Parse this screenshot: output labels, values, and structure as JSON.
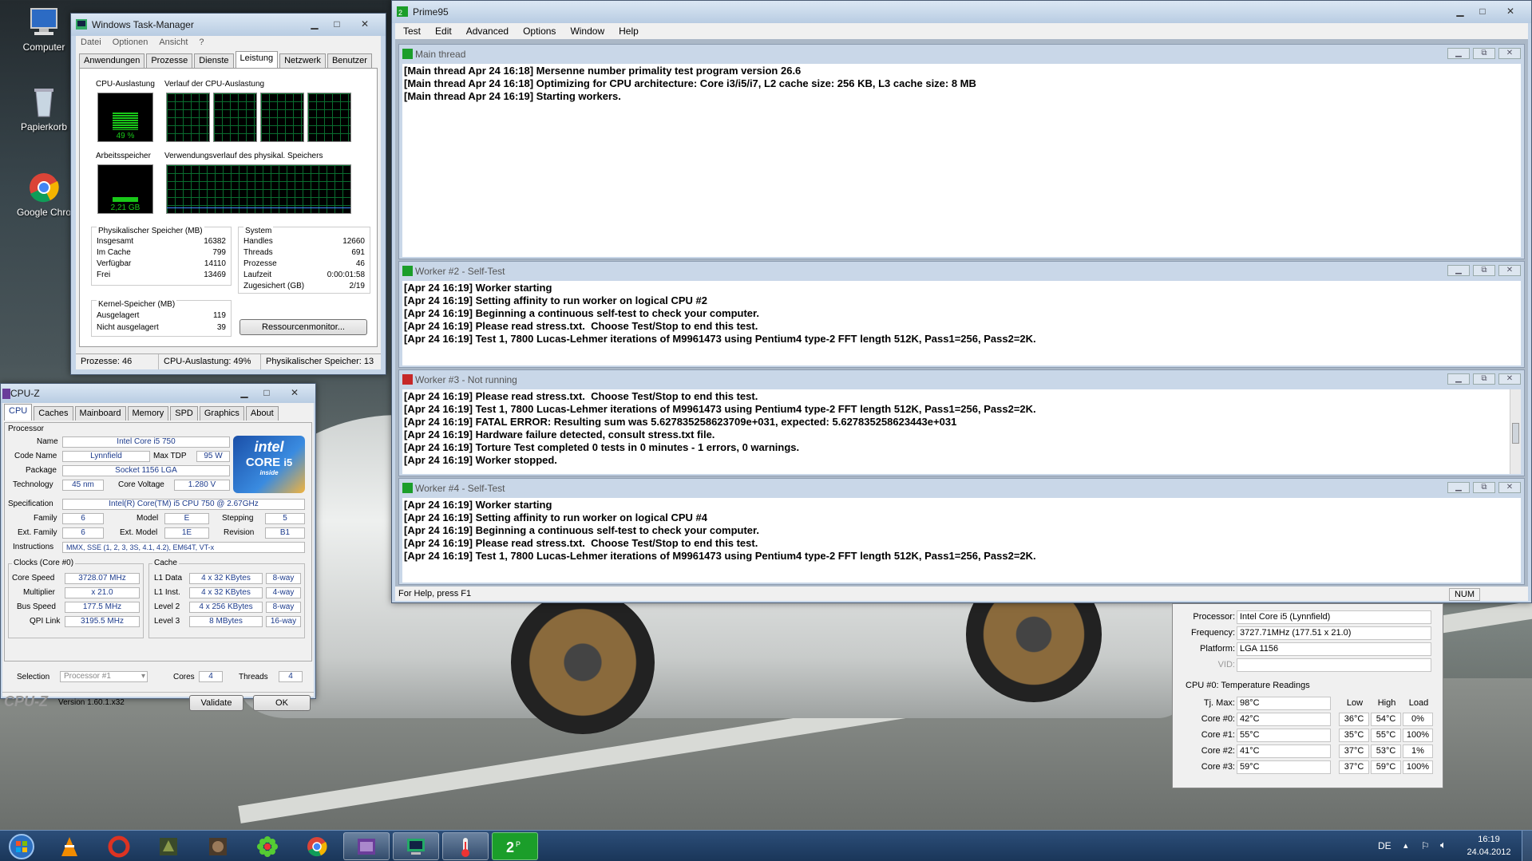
{
  "desktop": {
    "icons": [
      {
        "label": "Computer",
        "icon": "computer-icon"
      },
      {
        "label": "Papierkorb",
        "icon": "recycle-bin-icon"
      },
      {
        "label": "Google Chro",
        "icon": "chrome-icon"
      }
    ]
  },
  "taskmanager": {
    "title": "Windows Task-Manager",
    "menu": [
      "Datei",
      "Optionen",
      "Ansicht",
      "?"
    ],
    "tabs": [
      "Anwendungen",
      "Prozesse",
      "Dienste",
      "Leistung",
      "Netzwerk",
      "Benutzer"
    ],
    "active_tab": "Leistung",
    "cpu_label": "CPU-Auslastung",
    "cpu_history_label": "Verlauf der CPU-Auslastung",
    "cpu_value": "49 %",
    "cpu_percent": 49,
    "mem_label": "Arbeitsspeicher",
    "mem_history_label": "Verwendungsverlauf des physikal. Speichers",
    "mem_value": "2,21 GB",
    "phys": {
      "title": "Physikalischer Speicher (MB)",
      "rows": [
        [
          "Insgesamt",
          "16382"
        ],
        [
          "Im Cache",
          "799"
        ],
        [
          "Verfügbar",
          "14110"
        ],
        [
          "Frei",
          "13469"
        ]
      ]
    },
    "system": {
      "title": "System",
      "rows": [
        [
          "Handles",
          "12660"
        ],
        [
          "Threads",
          "691"
        ],
        [
          "Prozesse",
          "46"
        ],
        [
          "Laufzeit",
          "0:00:01:58"
        ],
        [
          "Zugesichert (GB)",
          "2/19"
        ]
      ]
    },
    "kernel": {
      "title": "Kernel-Speicher (MB)",
      "rows": [
        [
          "Ausgelagert",
          "119"
        ],
        [
          "Nicht ausgelagert",
          "39"
        ]
      ]
    },
    "resmon_button": "Ressourcenmonitor...",
    "status": [
      "Prozesse: 46",
      "CPU-Auslastung: 49%",
      "Physikalischer Speicher: 13"
    ]
  },
  "prime95": {
    "title": "Prime95",
    "menu": [
      "Test",
      "Edit",
      "Advanced",
      "Options",
      "Window",
      "Help"
    ],
    "windows": [
      {
        "title": "Main thread",
        "lines": [
          "[Main thread Apr 24 16:18] Mersenne number primality test program version 26.6",
          "[Main thread Apr 24 16:18] Optimizing for CPU architecture: Core i3/i5/i7, L2 cache size: 256 KB, L3 cache size: 8 MB",
          "[Main thread Apr 24 16:19] Starting workers."
        ]
      },
      {
        "title": "Worker #2 - Self-Test",
        "lines": [
          "[Apr 24 16:19] Worker starting",
          "[Apr 24 16:19] Setting affinity to run worker on logical CPU #2",
          "[Apr 24 16:19] Beginning a continuous self-test to check your computer.",
          "[Apr 24 16:19] Please read stress.txt.  Choose Test/Stop to end this test.",
          "[Apr 24 16:19] Test 1, 7800 Lucas-Lehmer iterations of M9961473 using Pentium4 type-2 FFT length 512K, Pass1=256, Pass2=2K."
        ]
      },
      {
        "title": "Worker #3 - Not running",
        "lines": [
          "[Apr 24 16:19] Please read stress.txt.  Choose Test/Stop to end this test.",
          "[Apr 24 16:19] Test 1, 7800 Lucas-Lehmer iterations of M9961473 using Pentium4 type-2 FFT length 512K, Pass1=256, Pass2=2K.",
          "[Apr 24 16:19] FATAL ERROR: Resulting sum was 5.627835258623709e+031, expected: 5.627835258623443e+031",
          "[Apr 24 16:19] Hardware failure detected, consult stress.txt file.",
          "[Apr 24 16:19] Torture Test completed 0 tests in 0 minutes - 1 errors, 0 warnings.",
          "[Apr 24 16:19] Worker stopped."
        ]
      },
      {
        "title": "Worker #4 - Self-Test",
        "lines": [
          "[Apr 24 16:19] Worker starting",
          "[Apr 24 16:19] Setting affinity to run worker on logical CPU #4",
          "[Apr 24 16:19] Beginning a continuous self-test to check your computer.",
          "[Apr 24 16:19] Please read stress.txt.  Choose Test/Stop to end this test.",
          "[Apr 24 16:19] Test 1, 7800 Lucas-Lehmer iterations of M9961473 using Pentium4 type-2 FFT length 512K, Pass1=256, Pass2=2K."
        ]
      }
    ],
    "status_left": "For Help, press F1",
    "status_num": "NUM"
  },
  "cpuz": {
    "title": "CPU-Z",
    "tabs": [
      "CPU",
      "Caches",
      "Mainboard",
      "Memory",
      "SPD",
      "Graphics",
      "About"
    ],
    "processor_group": "Processor",
    "name_l": "Name",
    "name": "Intel Core i5 750",
    "codename_l": "Code Name",
    "codename": "Lynnfield",
    "tdp_l": "Max TDP",
    "tdp": "95 W",
    "package_l": "Package",
    "package": "Socket 1156 LGA",
    "tech_l": "Technology",
    "tech": "45 nm",
    "voltage_l": "Core Voltage",
    "voltage": "1.280 V",
    "spec_l": "Specification",
    "spec": "Intel(R) Core(TM) i5 CPU       750  @ 2.67GHz",
    "family_l": "Family",
    "family": "6",
    "model_l": "Model",
    "model": "E",
    "stepping_l": "Stepping",
    "stepping": "5",
    "extfamily_l": "Ext. Family",
    "extfamily": "6",
    "extmodel_l": "Ext. Model",
    "extmodel": "1E",
    "revision_l": "Revision",
    "revision": "B1",
    "instr_l": "Instructions",
    "instr": "MMX, SSE (1, 2, 3, 3S, 4.1, 4.2), EM64T, VT-x",
    "clocks_group": "Clocks (Core #0)",
    "corespeed_l": "Core Speed",
    "corespeed": "3728.07 MHz",
    "mult_l": "Multiplier",
    "mult": "x 21.0",
    "bus_l": "Bus Speed",
    "bus": "177.5 MHz",
    "qpi_l": "QPI Link",
    "qpi": "3195.5 MHz",
    "cache_group": "Cache",
    "l1d_l": "L1 Data",
    "l1d": "4 x 32 KBytes",
    "l1d_w": "8-way",
    "l1i_l": "L1 Inst.",
    "l1i": "4 x 32 KBytes",
    "l1i_w": "4-way",
    "l2_l": "Level 2",
    "l2": "4 x 256 KBytes",
    "l2_w": "8-way",
    "l3_l": "Level 3",
    "l3": "8 MBytes",
    "l3_w": "16-way",
    "selection_l": "Selection",
    "selection": "Processor #1",
    "cores_l": "Cores",
    "cores": "4",
    "threads_l": "Threads",
    "threads": "4",
    "brand": "CPU-Z",
    "version": "Version 1.60.1.x32",
    "validate": "Validate",
    "ok": "OK",
    "logo_top": "intel",
    "logo_mid": "CORE",
    "logo_i5": "i5",
    "logo_inside": "inside"
  },
  "coretemp": {
    "processor_l": "Processor:",
    "processor": "Intel Core i5 (Lynnfield)",
    "frequency_l": "Frequency:",
    "frequency": "3727.71MHz (177.51 x 21.0)",
    "platform_l": "Platform:",
    "platform": "LGA 1156",
    "vid_l": "VID:",
    "vid": "",
    "readings_title": "CPU #0: Temperature Readings",
    "tjmax_l": "Tj. Max:",
    "tjmax": "98°C",
    "headers": [
      "Low",
      "High",
      "Load"
    ],
    "cores": [
      {
        "label": "Core #0:",
        "temp": "42°C",
        "low": "36°C",
        "high": "54°C",
        "load": "0%"
      },
      {
        "label": "Core #1:",
        "temp": "55°C",
        "low": "35°C",
        "high": "55°C",
        "load": "100%"
      },
      {
        "label": "Core #2:",
        "temp": "41°C",
        "low": "37°C",
        "high": "53°C",
        "load": "1%"
      },
      {
        "label": "Core #3:",
        "temp": "59°C",
        "low": "37°C",
        "high": "59°C",
        "load": "100%"
      }
    ]
  },
  "taskbar": {
    "apps": [
      "start-orb-icon",
      "vlc-icon",
      "ccleaner-icon",
      "game-icon-1",
      "game-icon-2",
      "icq-icon",
      "chrome-icon",
      "cpuz-icon",
      "task-manager-icon",
      "coretemp-icon",
      "prime95-icon"
    ],
    "lang": "DE",
    "time": "16:19",
    "date": "24.04.2012"
  },
  "colors": {
    "graph_green": "#19c819",
    "fatal_text": "#000000",
    "taskbar": "#1f3d63"
  }
}
